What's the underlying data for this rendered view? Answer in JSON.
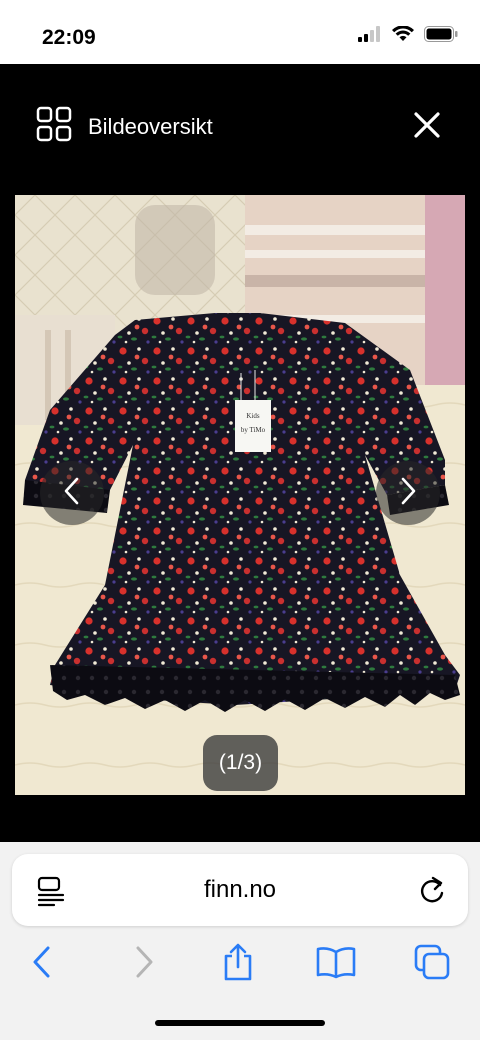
{
  "status": {
    "time": "22:09"
  },
  "viewer": {
    "overview_label": "Bildeoversikt",
    "counter": "(1/3)",
    "photo": {
      "tag_line1": "Kids",
      "tag_line2": "by TiMo"
    }
  },
  "browser": {
    "url": "finn.no"
  },
  "colors": {
    "accent": "#2a7cf6",
    "toolbar_disabled": "#b5b5b5"
  }
}
